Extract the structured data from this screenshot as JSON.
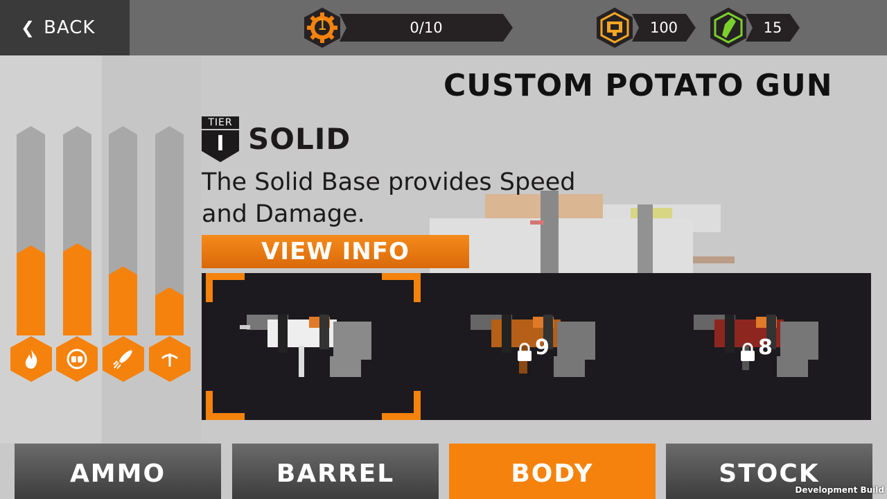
{
  "header": {
    "back_label": "BACK",
    "level": "1",
    "progress": "0/10",
    "coins": "100",
    "gems": "15"
  },
  "title": "CUSTOM POTATO GUN",
  "part": {
    "tier_label": "TIER",
    "tier_value": "I",
    "name": "SOLID",
    "description": "The Solid Base provides Speed and Damage.",
    "view_info_label": "VIEW INFO"
  },
  "stats": [
    {
      "icon": "fire-icon",
      "level": 0.43
    },
    {
      "icon": "fists-icon",
      "level": 0.44
    },
    {
      "icon": "rocket-icon",
      "level": 0.33
    },
    {
      "icon": "spin-icon",
      "level": 0.23
    }
  ],
  "items": [
    {
      "name": "white-body",
      "locked": false,
      "selected": true,
      "color": "#e8e8e8"
    },
    {
      "name": "orange-body",
      "locked": true,
      "unlock_level": "9",
      "color": "#c96a1a"
    },
    {
      "name": "red-body",
      "locked": true,
      "unlock_level": "8",
      "color": "#a42a22"
    }
  ],
  "tabs": [
    {
      "label": "AMMO",
      "active": false
    },
    {
      "label": "BARREL",
      "active": false
    },
    {
      "label": "BODY",
      "active": true
    },
    {
      "label": "STOCK",
      "active": false
    }
  ],
  "dev_build_label": "Development Build",
  "colors": {
    "accent": "#f5820c",
    "coin": "#f5a623",
    "gem": "#7ad12c"
  }
}
